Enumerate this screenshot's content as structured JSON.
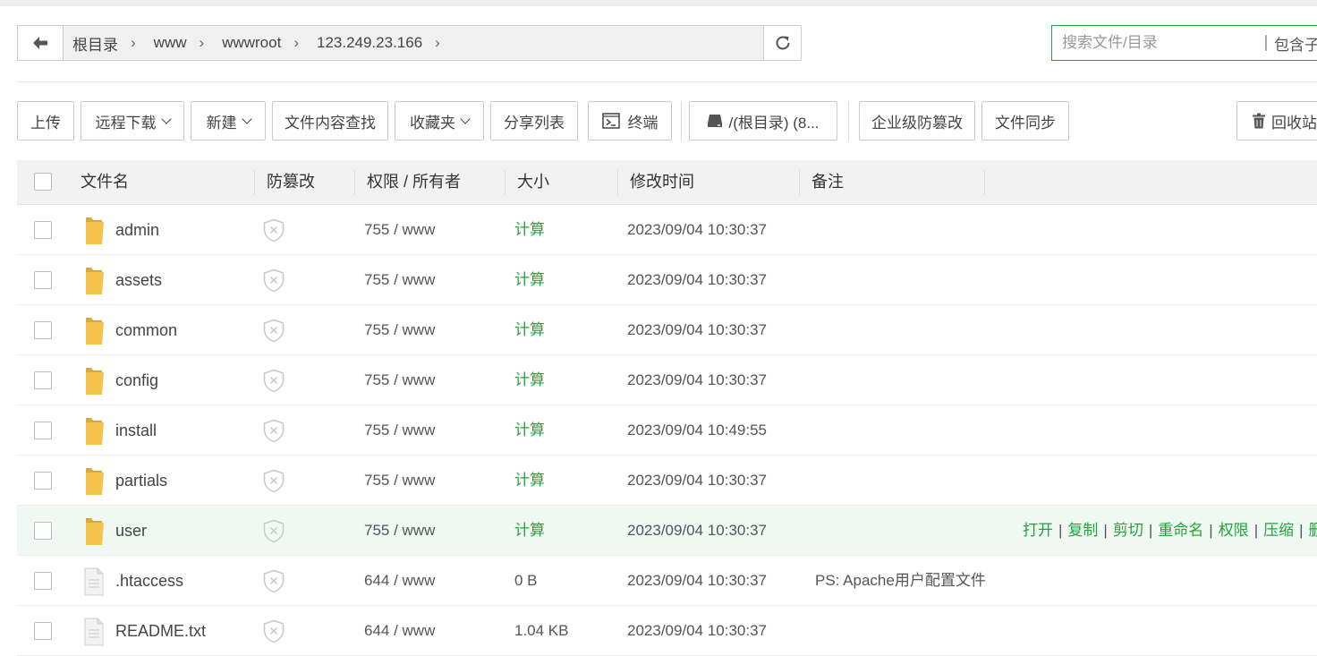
{
  "breadcrumbs": [
    "根目录",
    "www",
    "wwwroot",
    "123.249.23.166"
  ],
  "search": {
    "placeholder": "搜索文件/目录",
    "include_sub_label": "包含子目录"
  },
  "toolbar": {
    "upload": "上传",
    "remote_download": "远程下载",
    "new": "新建",
    "content_search": "文件内容查找",
    "favorites": "收藏夹",
    "share_list": "分享列表",
    "terminal": "终端",
    "disk": "/(根目录) (8...",
    "tamper_proof": "企业级防篡改",
    "file_sync": "文件同步",
    "recycle_bin": "回收站"
  },
  "columns": {
    "name": "文件名",
    "tamper": "防篡改",
    "perm": "权限 / 所有者",
    "size": "大小",
    "mtime": "修改时间",
    "note": "备注"
  },
  "files": [
    {
      "name": "admin",
      "type": "folder",
      "perm": "755 / www",
      "size": "计算",
      "mtime": "2023/09/04 10:30:37",
      "note": ""
    },
    {
      "name": "assets",
      "type": "folder",
      "perm": "755 / www",
      "size": "计算",
      "mtime": "2023/09/04 10:30:37",
      "note": ""
    },
    {
      "name": "common",
      "type": "folder",
      "perm": "755 / www",
      "size": "计算",
      "mtime": "2023/09/04 10:30:37",
      "note": ""
    },
    {
      "name": "config",
      "type": "folder",
      "perm": "755 / www",
      "size": "计算",
      "mtime": "2023/09/04 10:30:37",
      "note": ""
    },
    {
      "name": "install",
      "type": "folder",
      "perm": "755 / www",
      "size": "计算",
      "mtime": "2023/09/04 10:49:55",
      "note": ""
    },
    {
      "name": "partials",
      "type": "folder",
      "perm": "755 / www",
      "size": "计算",
      "mtime": "2023/09/04 10:30:37",
      "note": ""
    },
    {
      "name": "user",
      "type": "folder",
      "perm": "755 / www",
      "size": "计算",
      "mtime": "2023/09/04 10:30:37",
      "note": ""
    },
    {
      "name": ".htaccess",
      "type": "file",
      "perm": "644 / www",
      "size": "0 B",
      "mtime": "2023/09/04 10:30:37",
      "note": "PS: Apache用户配置文件"
    },
    {
      "name": "README.txt",
      "type": "file",
      "perm": "644 / www",
      "size": "1.04 KB",
      "mtime": "2023/09/04 10:30:37",
      "note": ""
    }
  ],
  "hover_row_actions": [
    "打开",
    "复制",
    "剪切",
    "重命名",
    "权限",
    "压缩",
    "删除"
  ],
  "colors": {
    "accent": "#20a53a",
    "hover_row": "#f0f8f3",
    "folder": "#f5c44f"
  }
}
